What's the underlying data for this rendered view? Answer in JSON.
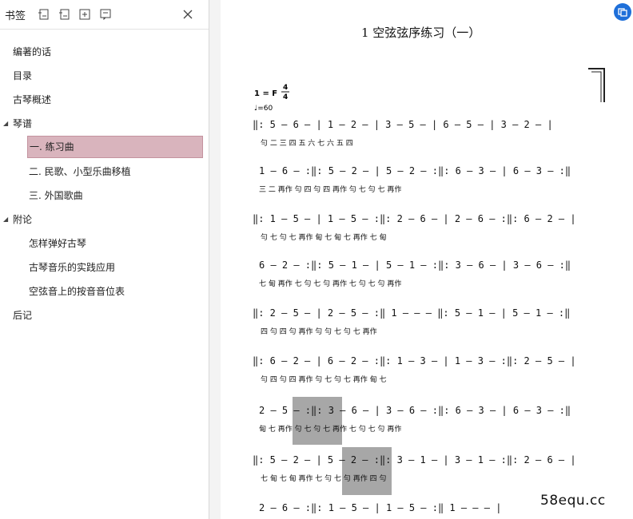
{
  "sidebar": {
    "title": "书签",
    "items": [
      {
        "label": "编著的话"
      },
      {
        "label": "目录"
      },
      {
        "label": "古琴概述"
      },
      {
        "label": "琴谱"
      },
      {
        "label": "一. 练习曲"
      },
      {
        "label": "二. 民歌、小型乐曲移植"
      },
      {
        "label": "三. 外国歌曲"
      },
      {
        "label": "附论"
      },
      {
        "label": "怎样弹好古琴"
      },
      {
        "label": "古琴音乐的实践应用"
      },
      {
        "label": "空弦音上的按音音位表"
      },
      {
        "label": "后记"
      }
    ],
    "toolbar_icons": [
      "expand-all-icon",
      "collapse-all-icon",
      "add-bookmark-icon",
      "bookmark-icon"
    ]
  },
  "document": {
    "title": "1 空弦弦序练习（一）",
    "key": "1 = F",
    "time_top": "4",
    "time_bottom": "4",
    "tempo": "♩=60",
    "watermark": "58equ.cc",
    "rows": [
      {
        "notes": "‖: 5 — 6 — | 1 — 2 — | 3 — 5 — | 6 — 5 — | 3 — 2 — |",
        "fingering": "勻   二     三    四     五   六     七    六     五   四"
      },
      {
        "notes": "1 — 6 — :‖: 5 — 2 — | 5 — 2 — :‖: 6 — 3 — | 6 — 3 — :‖",
        "fingering": "三   二  再作   勻   四     勻   四  再作   勻   七     勻   七  再作"
      },
      {
        "notes": "‖: 1 — 5 — | 1 — 5 — :‖: 2 — 6 — | 2 — 6 — :‖: 6 — 2 — |",
        "fingering": "勻   七     勻   七  再作   甸   七     甸   七  再作   七   甸"
      },
      {
        "notes": "6 — 2 — :‖: 5 — 1 — | 5 — 1 — :‖: 3 — 6 — | 3 — 6 — :‖",
        "fingering": "七   甸  再作   七   勻     七   勻  再作   七   勻     七   勻  再作"
      },
      {
        "notes": "‖: 2 — 5 — | 2 — 5 — :‖ 1 — — — ‖: 5 — 1 — | 5 — 1 — :‖",
        "fingering": "四   勻     四   勻  再作   勻           勻   七     勻   七  再作"
      },
      {
        "notes": "‖: 6 — 2 — | 6 — 2 — :‖: 1 — 3 — | 1 — 3 — :‖: 2 — 5 — |",
        "fingering": "勻   四     勻   四  再作   勻   七     勻   七  再作   甸   七"
      },
      {
        "notes": "2 — 5 — :‖: 3 — 6 — | 3 — 6 — :‖: 6 — 3 — | 6 — 3 — :‖",
        "fingering": "甸   七  再作   勻   七     勻   七  再作   七   勻     七   勻  再作"
      },
      {
        "notes": "‖: 5 — 2 — | 5 — 2 — :‖: 3 — 1 — | 3 — 1 — :‖: 2 — 6 — |",
        "fingering": "七   甸     七   甸  再作   七   勻     七   勻  再作   四   勻"
      },
      {
        "notes": "2 — 6 — :‖: 1 — 5 — | 1 — 5 — :‖ 1 — — — |",
        "fingering": ""
      }
    ]
  }
}
